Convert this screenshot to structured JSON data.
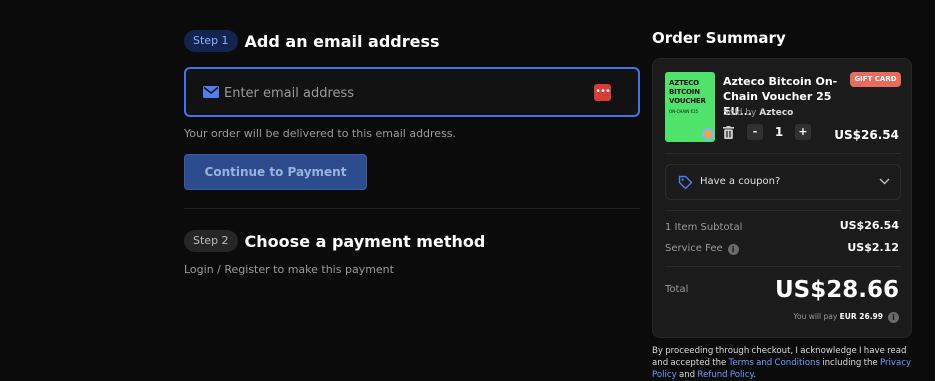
{
  "checkout": {
    "step1": {
      "badge": "Step 1",
      "title": "Add an email address",
      "email_placeholder": "Enter email address",
      "email_value": "",
      "hint": "Your order will be delivered to this email address.",
      "continue_label": "Continue to Payment"
    },
    "step2": {
      "badge": "Step 2",
      "title": "Choose a payment method",
      "hint": "Login / Register to make this payment"
    }
  },
  "order_summary": {
    "title": "Order Summary",
    "product": {
      "name": "Azteco Bitcoin On-Chain Voucher 25 EU...",
      "sold_by_label": "Sold by",
      "seller": "Azteco",
      "badge": "GIFT CARD",
      "voucher_title": "AZTECO BITCOIN VOUCHER",
      "voucher_subtitle": "ON-CHAIN €25",
      "quantity": "1",
      "minus": "-",
      "plus": "+",
      "price": "US$26.54"
    },
    "coupon_label": "Have a coupon?",
    "subtotal_label": "1 Item Subtotal",
    "subtotal_value": "US$26.54",
    "service_fee_label": "Service Fee",
    "service_fee_value": "US$2.12",
    "total_label": "Total",
    "total_value": "US$28.66",
    "you_pay_label": "You will pay",
    "you_pay_value": "EUR 26.99"
  },
  "disclaimer": {
    "text1": "By proceeding through checkout, I acknowledge I have read and accepted the",
    "terms_link": "Terms and Conditions",
    "text2": "including the",
    "privacy_link": "Privacy Policy",
    "text3": "and",
    "refund_link": "Refund Policy",
    "text4": "."
  },
  "colors": {
    "background": "#0b0b0b",
    "accent": "#3f74e8",
    "link": "#6d9bff",
    "voucher_green": "#4fe36b",
    "gift_badge": "#e86b5e",
    "password_icon": "#d83c35"
  },
  "icons": [
    "mail-icon",
    "password-manager-icon",
    "trash-icon",
    "tag-icon",
    "chevron-down-icon",
    "info-icon"
  ]
}
